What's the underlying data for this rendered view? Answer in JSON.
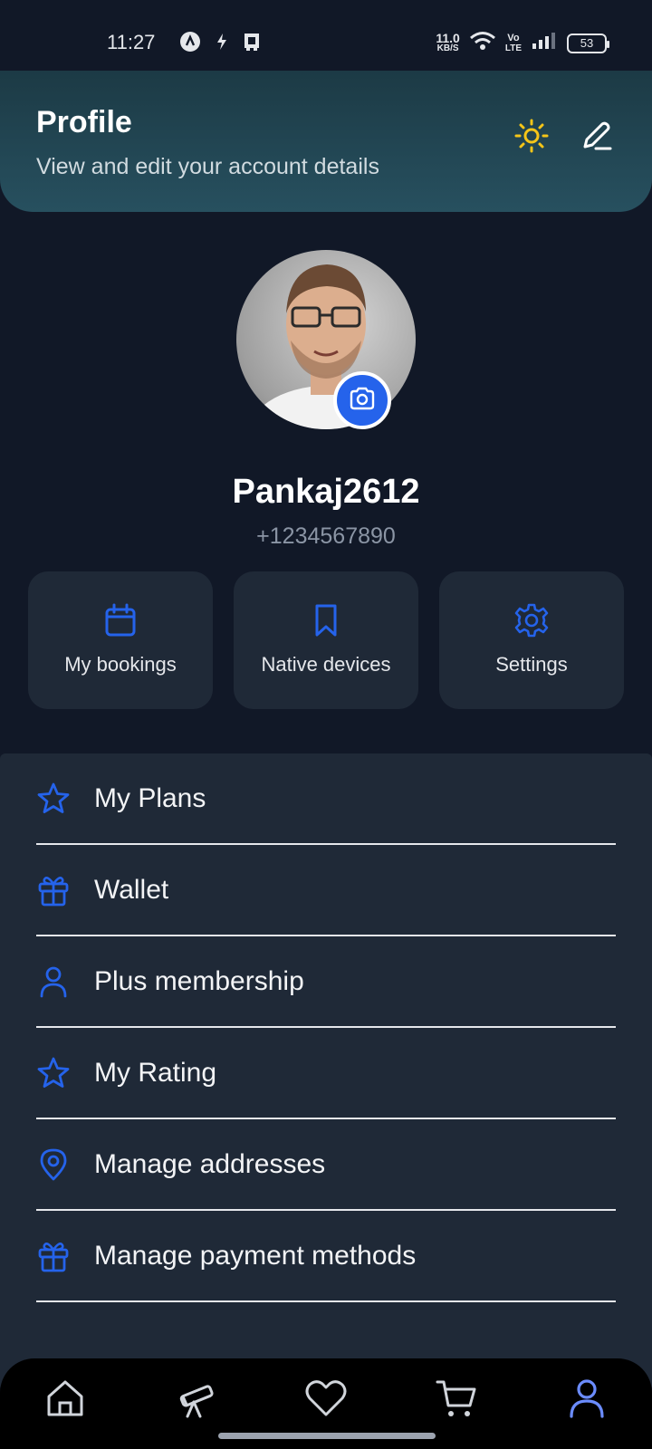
{
  "status_bar": {
    "time": "11:27",
    "speed_value": "11.0",
    "speed_unit": "KB/S",
    "network_label_top": "Vo",
    "network_label_bottom": "LTE",
    "battery": "53"
  },
  "header": {
    "title": "Profile",
    "subtitle": "View and edit your account details"
  },
  "profile": {
    "username": "Pankaj2612",
    "phone": "+1234567890"
  },
  "quick_actions": [
    {
      "label": "My bookings",
      "icon": "calendar-icon"
    },
    {
      "label": "Native devices",
      "icon": "bookmark-icon"
    },
    {
      "label": "Settings",
      "icon": "gear-icon"
    }
  ],
  "menu": [
    {
      "label": "My Plans",
      "icon": "star-icon"
    },
    {
      "label": "Wallet",
      "icon": "gift-icon"
    },
    {
      "label": "Plus membership",
      "icon": "user-icon"
    },
    {
      "label": "My Rating",
      "icon": "star-icon"
    },
    {
      "label": "Manage addresses",
      "icon": "location-pin-icon"
    },
    {
      "label": "Manage payment methods",
      "icon": "gift-icon"
    }
  ],
  "bottom_nav": {
    "active": "profile",
    "items": [
      "home-icon",
      "telescope-icon",
      "heart-icon",
      "cart-icon",
      "profile-icon"
    ]
  },
  "colors": {
    "accent": "#2563eb",
    "sun": "#f5c518",
    "active_nav": "#6b8cff",
    "background": "#111827",
    "card": "#1f2937"
  }
}
